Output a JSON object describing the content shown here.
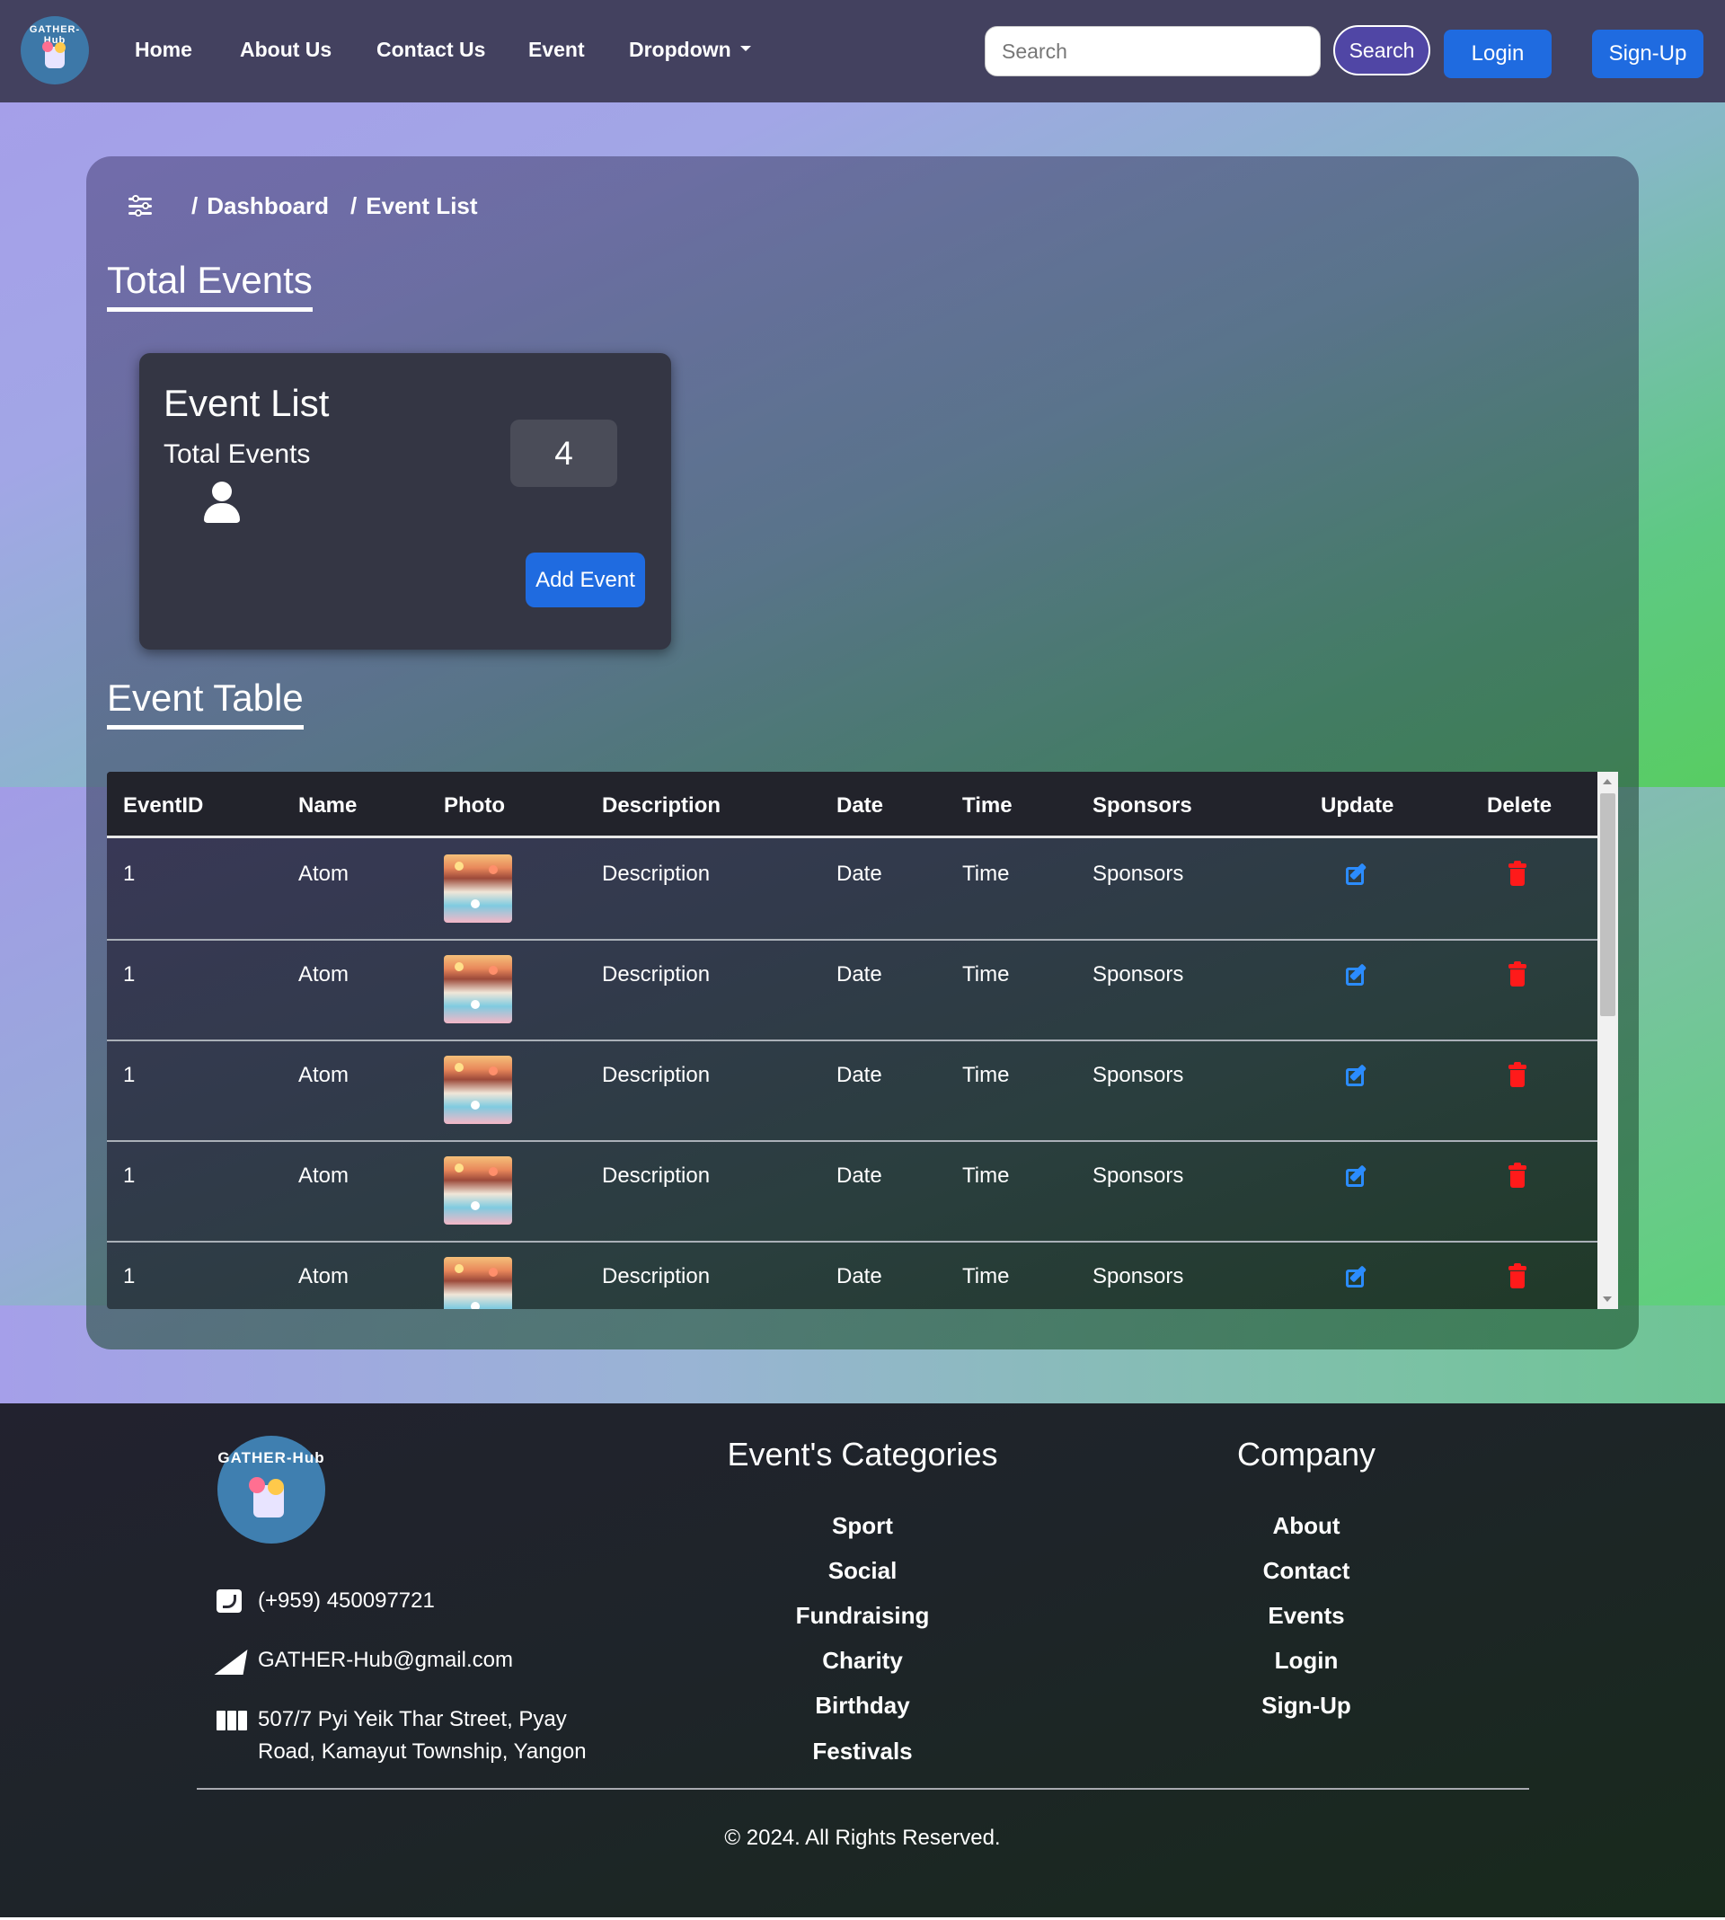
{
  "nav": {
    "logo_text": "GATHER-Hub",
    "links": [
      "Home",
      "About Us",
      "Contact Us",
      "Event",
      "Dropdown"
    ],
    "search_placeholder": "Search",
    "search_button": "Search",
    "login": "Login",
    "signup": "Sign-Up"
  },
  "breadcrumb": {
    "items": [
      "Dashboard",
      "Event List"
    ],
    "separator": "/"
  },
  "headings": {
    "total_events": "Total Events",
    "event_table": "Event Table"
  },
  "card": {
    "title": "Event List",
    "subtitle": "Total Events",
    "count": "4",
    "add_button": "Add Event"
  },
  "table": {
    "columns": [
      "EventID",
      "Name",
      "Photo",
      "Description",
      "Date",
      "Time",
      "Sponsors",
      "Update",
      "Delete"
    ],
    "rows": [
      {
        "id": "1",
        "name": "Atom",
        "description": "Description",
        "date": "Date",
        "time": "Time",
        "sponsors": "Sponsors"
      },
      {
        "id": "1",
        "name": "Atom",
        "description": "Description",
        "date": "Date",
        "time": "Time",
        "sponsors": "Sponsors"
      },
      {
        "id": "1",
        "name": "Atom",
        "description": "Description",
        "date": "Date",
        "time": "Time",
        "sponsors": "Sponsors"
      },
      {
        "id": "1",
        "name": "Atom",
        "description": "Description",
        "date": "Date",
        "time": "Time",
        "sponsors": "Sponsors"
      },
      {
        "id": "1",
        "name": "Atom",
        "description": "Description",
        "date": "Date",
        "time": "Time",
        "sponsors": "Sponsors"
      }
    ],
    "icons": {
      "update": "edit-icon",
      "delete": "trash-icon"
    }
  },
  "footer": {
    "logo_text": "GATHER-Hub",
    "phone": "(+959) 450097721",
    "email": "GATHER-Hub@gmail.com",
    "address_line1": "507/7 Pyi Yeik Thar Street, Pyay",
    "address_line2": "Road, Kamayut Township, Yangon",
    "categories_title": "Event's Categories",
    "categories": [
      "Sport",
      "Social",
      "Fundraising",
      "Charity",
      "Birthday",
      "Festivals"
    ],
    "company_title": "Company",
    "company": [
      "About",
      "Contact",
      "Events",
      "Login",
      "Sign-Up"
    ],
    "copyright": "© 2024. All Rights Reserved."
  },
  "colors": {
    "navbar": "#43415f",
    "primary_button": "#1f6be0",
    "search_button": "#5046a5",
    "edit_icon": "#2b8cff",
    "delete_icon": "#ff1a1a"
  }
}
